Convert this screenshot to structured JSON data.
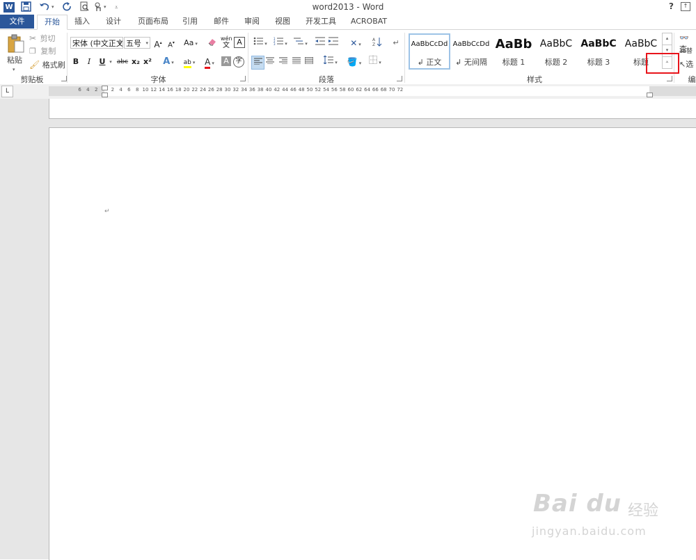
{
  "window": {
    "title": "word2013 - Word",
    "help": "?"
  },
  "quick_access": {
    "app_icon": "W"
  },
  "tabs": [
    {
      "label": "文件"
    },
    {
      "label": "开始"
    },
    {
      "label": "插入"
    },
    {
      "label": "设计"
    },
    {
      "label": "页面布局"
    },
    {
      "label": "引用"
    },
    {
      "label": "邮件"
    },
    {
      "label": "审阅"
    },
    {
      "label": "视图"
    },
    {
      "label": "开发工具"
    },
    {
      "label": "ACROBAT"
    }
  ],
  "clipboard": {
    "paste": "粘贴",
    "cut": "剪切",
    "copy": "复制",
    "format_painter": "格式刷",
    "group_label": "剪贴板"
  },
  "font": {
    "font_name": "宋体 (中文正文",
    "font_size": "五号",
    "grow": "A",
    "shrink": "A",
    "case": "Aa",
    "bold": "B",
    "italic": "I",
    "underline": "U",
    "strike": "abc",
    "subscript": "x₂",
    "superscript": "x²",
    "phonetic": "wén",
    "group_label": "字体"
  },
  "paragraph": {
    "group_label": "段落"
  },
  "styles": {
    "items": [
      {
        "sample": "AaBbCcDd",
        "name": "↲ 正文"
      },
      {
        "sample": "AaBbCcDd",
        "name": "↲ 无间隔"
      },
      {
        "sample": "AaBb",
        "name": "标题 1"
      },
      {
        "sample": "AaBbC",
        "name": "标题 2"
      },
      {
        "sample": "AaBbC",
        "name": "标题 3"
      },
      {
        "sample": "AaBbC",
        "name": "标题"
      }
    ],
    "group_label": "样式"
  },
  "editing": {
    "find": "查",
    "replace": "替",
    "select": "选",
    "group_label": "编"
  },
  "ruler": {
    "left_ticks": [
      "6",
      "4",
      "2"
    ],
    "right_ticks": [
      "2",
      "4",
      "6",
      "8",
      "10",
      "12",
      "14",
      "16",
      "18",
      "20",
      "22",
      "24",
      "26",
      "28",
      "30",
      "32",
      "34",
      "36",
      "38",
      "40",
      "42",
      "44",
      "46",
      "48",
      "50",
      "52",
      "54",
      "56",
      "58",
      "60",
      "62",
      "64",
      "66",
      "68",
      "70",
      "72"
    ],
    "tab_selector": "L"
  },
  "document": {
    "paragraph_mark": "↵"
  },
  "watermark": {
    "logo": "Bai du",
    "sub": "经验",
    "url": "jingyan.baidu.com"
  }
}
